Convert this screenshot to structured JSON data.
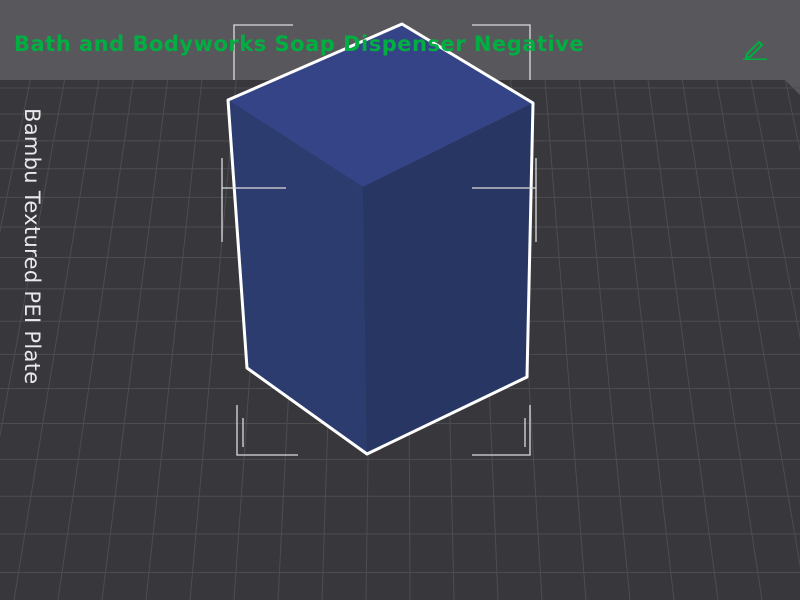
{
  "viewport": {
    "object_name": "Bath and Bodyworks Soap Dispenser Negative",
    "plate_name": "Bambu Textured PEI Plate",
    "edit_icon": "pencil-icon",
    "selected_object": "box",
    "colors": {
      "background": "#58585c",
      "plate": "#38383c",
      "grid": "#4d4d52",
      "object_top": "#344486",
      "object_left": "#2b3b6b",
      "object_right": "#283662",
      "selection_outline": "#ffffff",
      "title": "#00ae42"
    }
  }
}
